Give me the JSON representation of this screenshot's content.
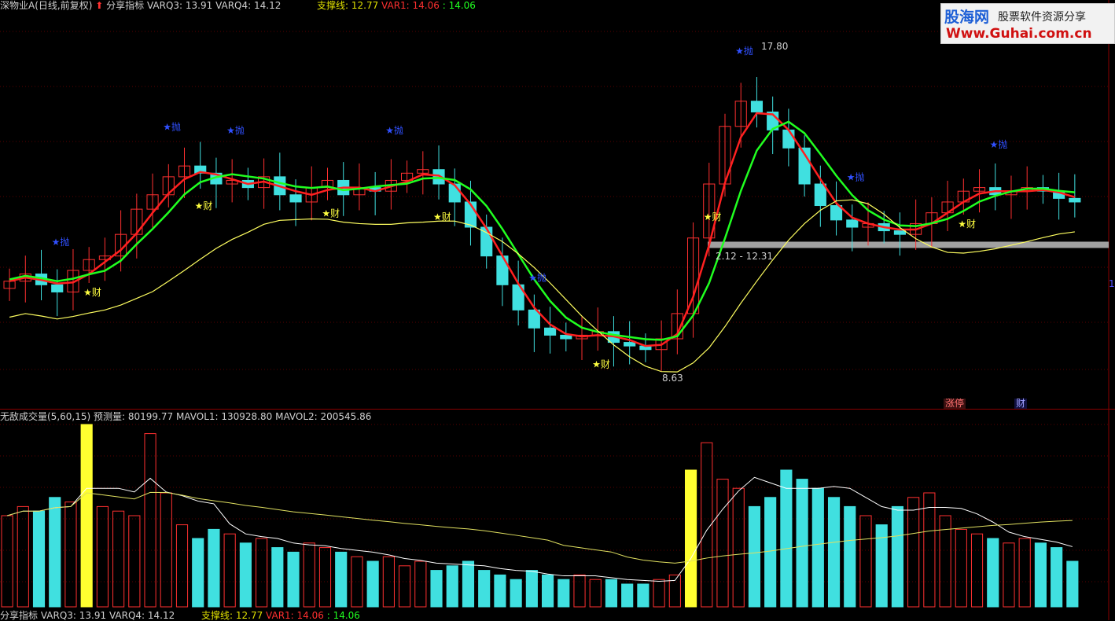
{
  "price_panel": {
    "stock_label": "深物业A(日线,前复权)",
    "indicator_name": "分享指标",
    "varq3_label": "VARQ3: 13.91",
    "varq4_label": "VARQ4: 14.12",
    "support_label": "支撑线: 12.77",
    "var1_label": "VAR1: 14.06",
    "var1_extra": ": 14.06",
    "high_label": "17.80",
    "low_label": "8.63",
    "range_label": "2.12 - 12.31",
    "scale_marker": "1",
    "buy_glyph": "★财",
    "sell_glyph": "★抛",
    "up_arrow_glyph": "⇩",
    "colors": {
      "background": "#000000",
      "up_candle": "#ff3030",
      "down_candle": "#40e0e0",
      "ma_red": "#ff2020",
      "ma_green": "#20ff20",
      "ma_yellow": "#ffff60",
      "support_band": "#a0a0a0"
    }
  },
  "volume_panel": {
    "indicator_label": "无敌成交量(5,60,15)",
    "forecast_label": "预测量: 80199.77",
    "mavol1_label": "MAVOL1: 130928.80",
    "mavol2_label": "MAVOL2: 200545.86"
  },
  "badges": {
    "limit_up": "涨停",
    "cai": "财"
  },
  "footer": {
    "indicator_name": "分享指标",
    "varq3_label": "VARQ3: 13.91",
    "varq4_label": "VARQ4: 14.12",
    "support_label": "支撑线: 12.77",
    "var1_label": "VAR1: 14.06",
    "var1_extra": ": 14.06"
  },
  "watermark": {
    "brand": "股海网",
    "slogan": "股票软件资源分享",
    "url": "Www.Guhai.com.cn"
  },
  "chart_data": {
    "type": "candlestick",
    "price_high": 17.8,
    "price_low": 8.63,
    "close_series_estimate": [
      11.3,
      11.5,
      11.2,
      11.0,
      11.6,
      11.9,
      12.0,
      12.6,
      13.3,
      13.7,
      14.2,
      14.5,
      14.3,
      14.0,
      14.1,
      13.9,
      14.2,
      13.7,
      13.5,
      13.9,
      14.1,
      13.7,
      13.9,
      13.8,
      14.1,
      14.3,
      14.4,
      14.0,
      13.5,
      12.8,
      12.0,
      11.2,
      10.5,
      10.0,
      9.8,
      9.7,
      9.8,
      9.9,
      9.6,
      9.5,
      9.4,
      9.7,
      10.4,
      12.5,
      14.0,
      15.6,
      16.3,
      16.0,
      15.5,
      15.0,
      14.0,
      13.4,
      13.0,
      12.8,
      12.9,
      12.7,
      12.6,
      12.9,
      13.2,
      13.5,
      13.8,
      13.9,
      13.7,
      13.8,
      13.9,
      13.8,
      13.6,
      13.5
    ],
    "volume_estimate": [
      20,
      22,
      21,
      24,
      23,
      40,
      22,
      21,
      20,
      38,
      25,
      18,
      15,
      17,
      16,
      14,
      15,
      13,
      12,
      14,
      13,
      12,
      11,
      10,
      11,
      9,
      10,
      8,
      9,
      10,
      8,
      7,
      6,
      8,
      7,
      6,
      7,
      6,
      6,
      5,
      5,
      6,
      7,
      30,
      36,
      28,
      26,
      22,
      24,
      30,
      28,
      26,
      24,
      22,
      20,
      18,
      22,
      24,
      25,
      20,
      17,
      16,
      15,
      14,
      15,
      14,
      13,
      10
    ]
  }
}
